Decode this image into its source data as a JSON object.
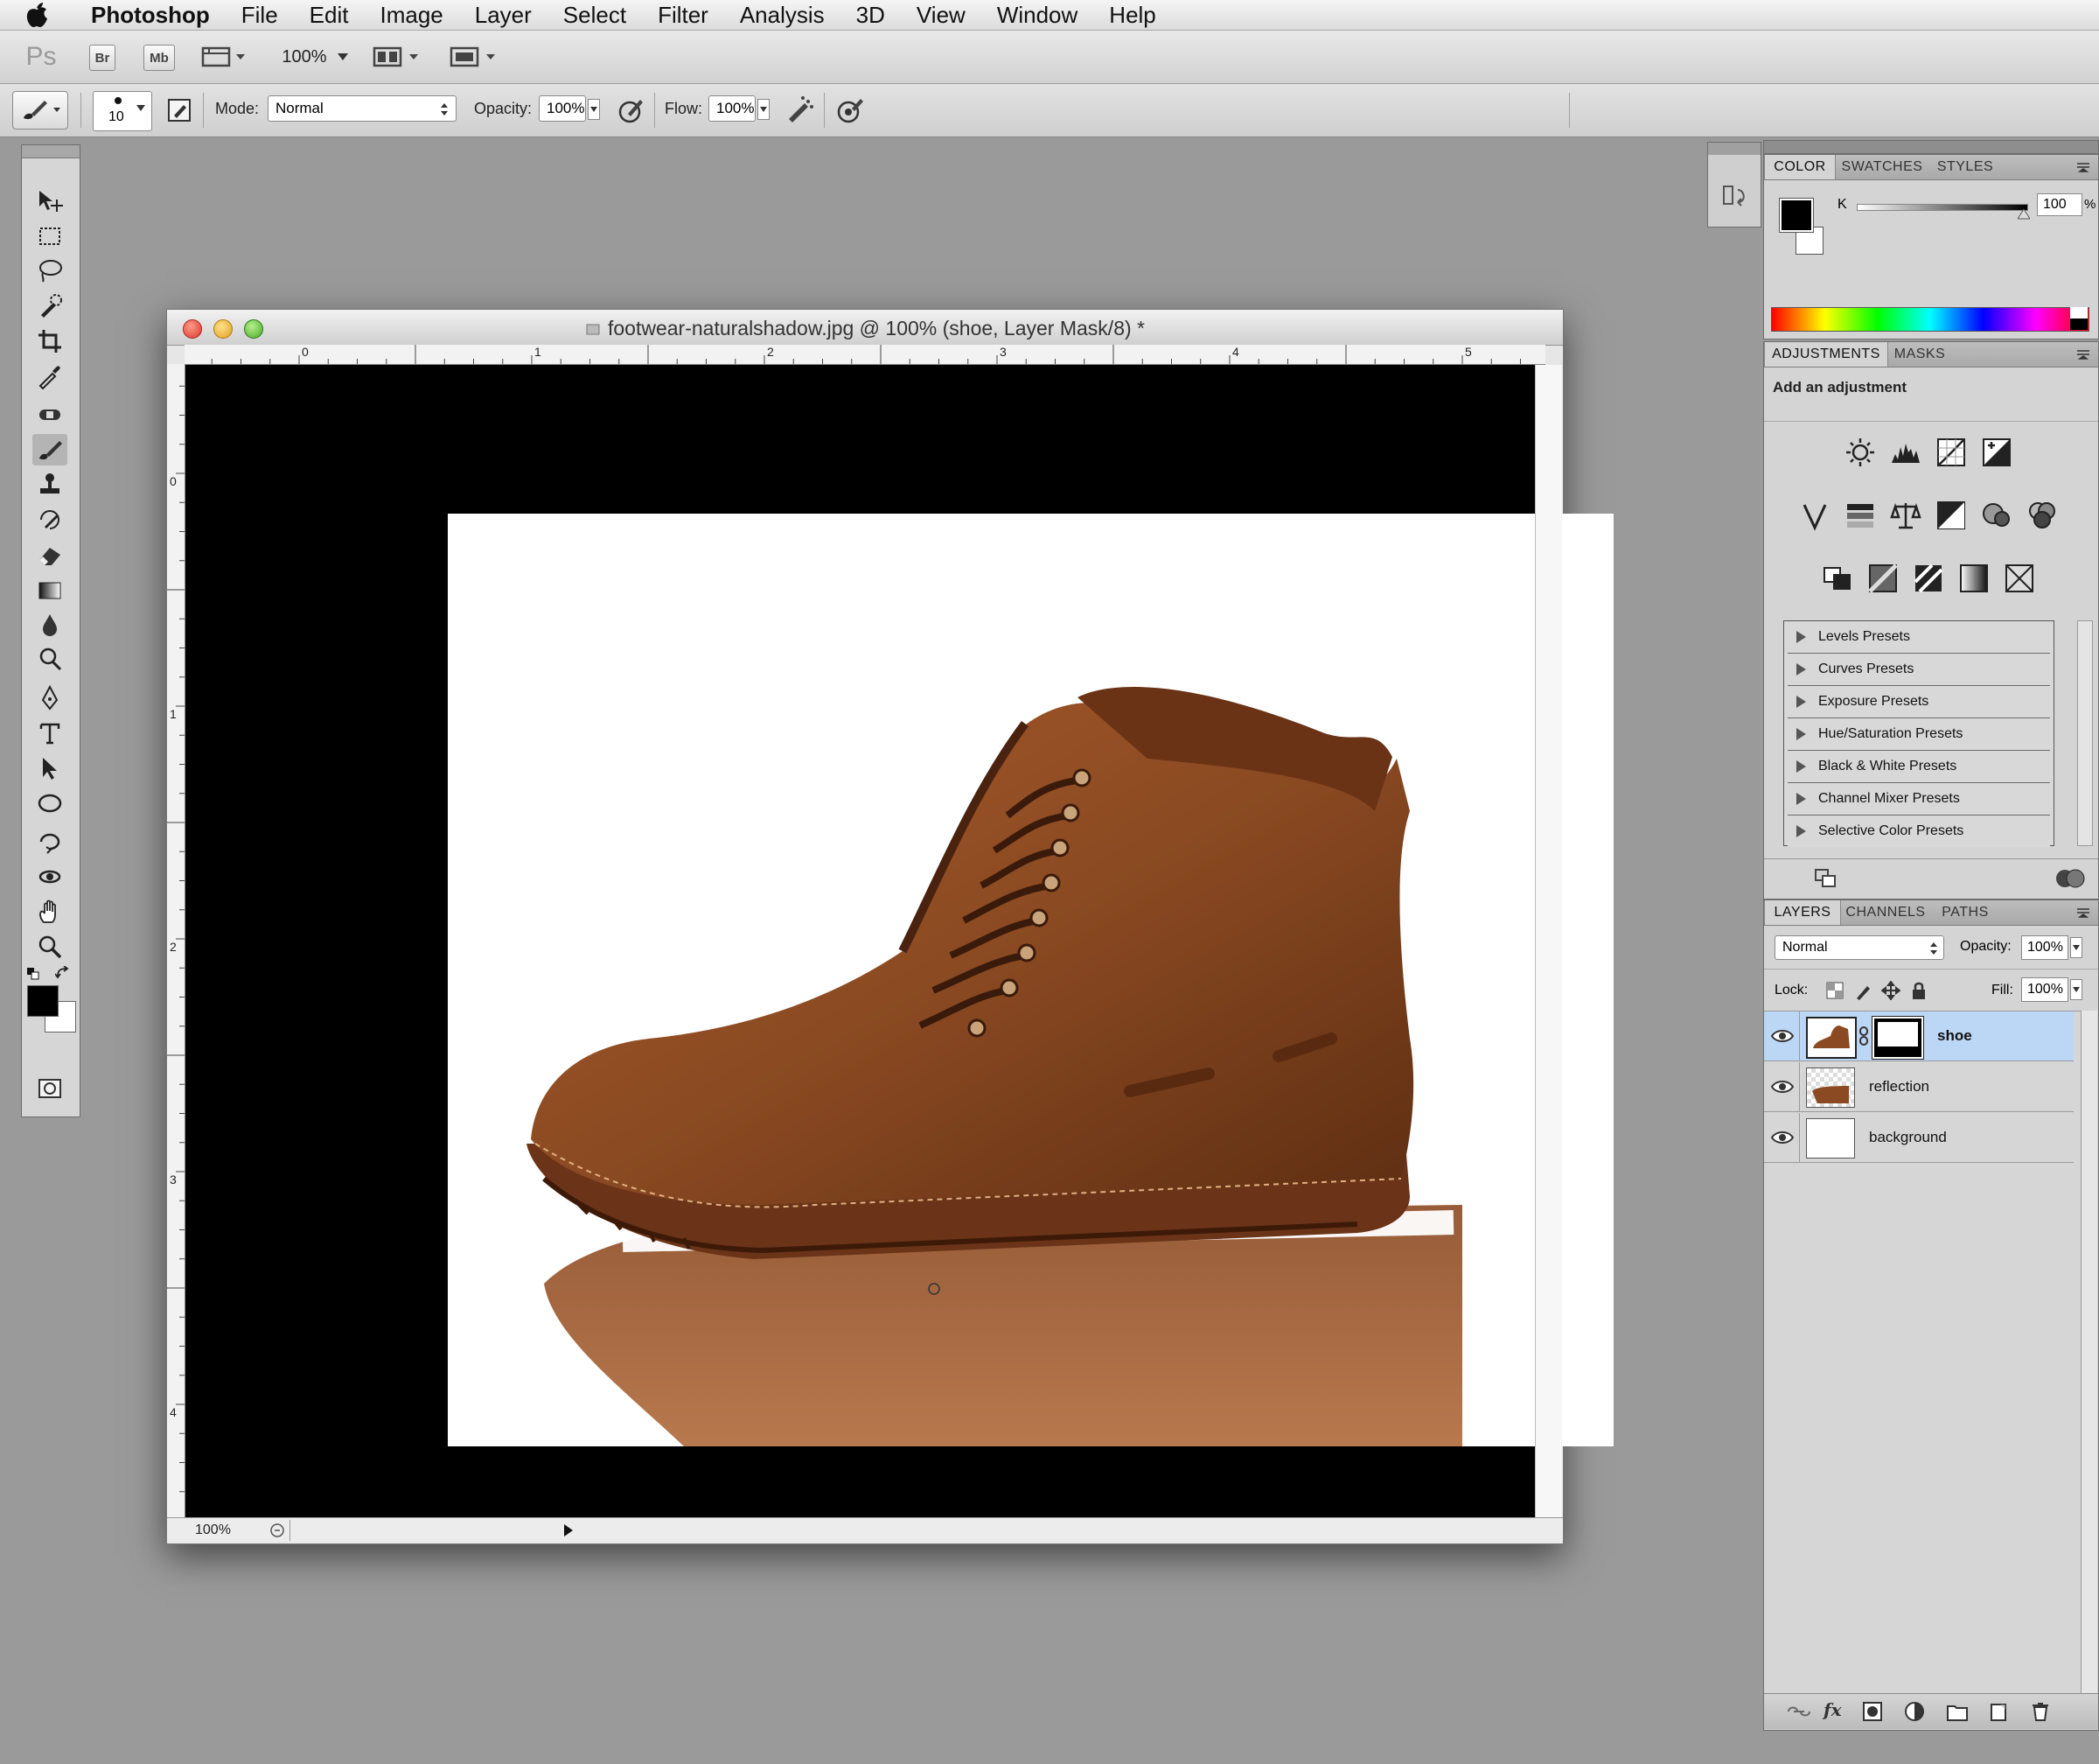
{
  "menubar": {
    "app_name": "Photoshop",
    "items": [
      "File",
      "Edit",
      "Image",
      "Layer",
      "Select",
      "Filter",
      "Analysis",
      "3D",
      "View",
      "Window",
      "Help"
    ]
  },
  "appbar": {
    "ps_logo": "Ps",
    "bridge_label": "Br",
    "minibridge_label": "Mb",
    "zoom": "100%"
  },
  "options": {
    "brush_size": "10",
    "mode_label": "Mode:",
    "mode_value": "Normal",
    "opacity_label": "Opacity:",
    "opacity_value": "100%",
    "flow_label": "Flow:",
    "flow_value": "100%"
  },
  "document": {
    "title": "footwear-naturalshadow.jpg @ 100% (shoe, Layer Mask/8) *",
    "zoom_status": "100%",
    "ruler_top_numbers": [
      "0",
      "1",
      "2",
      "3",
      "4",
      "5"
    ],
    "ruler_left_numbers": [
      "0",
      "1",
      "2",
      "3",
      "4"
    ]
  },
  "color_panel": {
    "tabs": [
      "COLOR",
      "SWATCHES",
      "STYLES"
    ],
    "channel_label": "K",
    "k_value": "100",
    "percent": "%",
    "foreground": "#000000",
    "background": "#ffffff"
  },
  "adjustments_panel": {
    "tabs": [
      "ADJUSTMENTS",
      "MASKS"
    ],
    "heading": "Add an adjustment",
    "presets": [
      "Levels Presets",
      "Curves Presets",
      "Exposure Presets",
      "Hue/Saturation Presets",
      "Black & White Presets",
      "Channel Mixer Presets",
      "Selective Color Presets"
    ]
  },
  "layers_panel": {
    "tabs": [
      "LAYERS",
      "CHANNELS",
      "PATHS"
    ],
    "blend_mode": "Normal",
    "opacity_label": "Opacity:",
    "opacity_value": "100%",
    "lock_label": "Lock:",
    "fill_label": "Fill:",
    "fill_value": "100%",
    "layers": [
      "shoe",
      "reflection",
      "background"
    ],
    "selected_layer": "shoe"
  },
  "colors": {
    "selection_blue": "#bcd6f5",
    "leather": "#8b4a22"
  }
}
